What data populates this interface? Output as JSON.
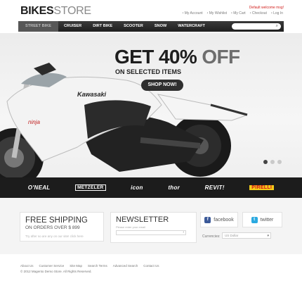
{
  "header": {
    "logo_bold": "BIKES",
    "logo_light": "STORE",
    "welcome": "Default welcome msg!",
    "links": [
      "My Account",
      "My Wishlist",
      "My Cart",
      "Checkout",
      "Log In"
    ]
  },
  "nav": {
    "items": [
      "STREET BIKE",
      "CRUISER",
      "DIRT BIKE",
      "SCOOTER",
      "SNOW",
      "WATERCRAFT"
    ],
    "search_icon": "search-icon"
  },
  "hero": {
    "headline_main": "GET 40%",
    "headline_off": "OFF",
    "subhead": "ON SELECTED ITEMS",
    "button": "SHOP NOW!",
    "fairing_text": "Kawasaki",
    "tank_text": "ninja"
  },
  "brands": [
    "O'NEAL",
    "METZELER",
    "icon",
    "thor",
    "REVIT!",
    "PIRELLI"
  ],
  "promo": {
    "free_title": "FREE SHIPPING",
    "free_sub": "ON ORDERS OVER $ 899",
    "free_note": "Try after so are any on our site! click here",
    "news_title": "NEWSLETTER",
    "news_hint": "Please enter your email",
    "news_go": "›",
    "facebook": "facebook",
    "twitter": "twitter",
    "currency_label": "Currencies:",
    "currency_value": "US Dollar"
  },
  "footer": {
    "links": [
      "About Us",
      "Customer Service",
      "Site Map",
      "Search Terms",
      "Advanced Search",
      "Contact Us"
    ],
    "copyright": "© 2012 Magento Demo Store. All Rights Reserved."
  },
  "colors": {
    "accent_red": "#d2221f",
    "nav_bg": "#262626",
    "brand_bar": "#1c1c1c"
  }
}
